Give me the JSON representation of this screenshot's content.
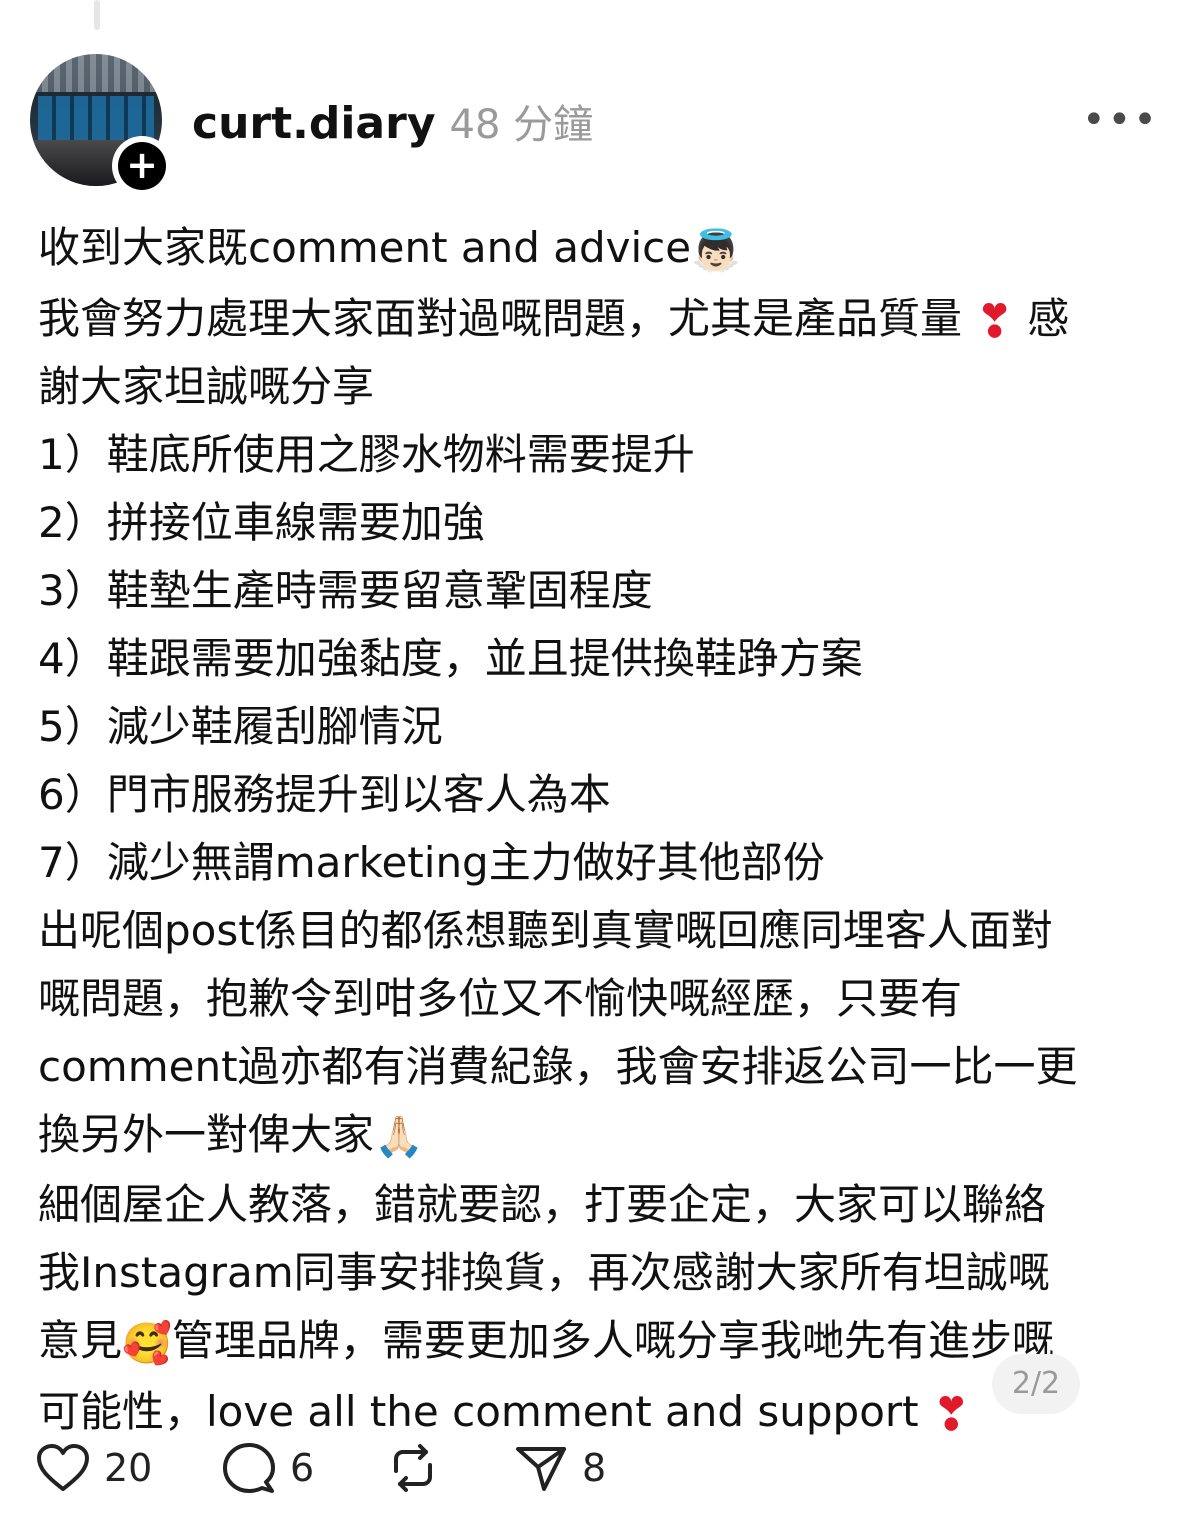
{
  "post": {
    "username": "curt.diary",
    "time": "48 分鐘",
    "more_label": "•••",
    "follow_symbol": "+",
    "lines": [
      "收到大家既comment and advice",
      "我會努力處理大家面對過嘅問題，尤其是產品質量",
      "謝大家坦誠嘅分享",
      "1）鞋底所使用之膠水物料需要提升",
      "2）拼接位車線需要加強",
      "3）鞋墊生產時需要留意鞏固程度",
      "4）鞋跟需要加強黏度，並且提供換鞋踭方案",
      "5）減少鞋履刮腳情況",
      "6）門市服務提升到以客人為本",
      "7）減少無謂marketing主力做好其他部份",
      "出呢個post係目的都係想聽到真實嘅回應同埋客人面對",
      "嘅問題，抱歉令到咁多位又不愉快嘅經歷，只要有",
      "comment過亦都有消費紀錄，我會安排返公司一比一更",
      "換另外一對俾大家",
      "細個屋企人教落，錯就要認，打要企定，大家可以聯絡",
      "我Instagram同事安排換貨，再次感謝大家所有坦誠嘅",
      "意見",
      "管理品牌，需要更加多人嘅分享我哋先有進步嘅",
      "可能性，love all the comment and support"
    ],
    "line2_tail": "感",
    "emojis": {
      "angel": "👼🏻",
      "heart": "❣",
      "pray": "🙏🏻",
      "smile_hearts": "🥰"
    },
    "page_indicator": "2/2"
  },
  "actions": {
    "likes": "20",
    "comments": "6",
    "shares": "8"
  },
  "colors": {
    "text": "#111111",
    "muted": "#9a9a9a",
    "heart": "#e0192b"
  }
}
